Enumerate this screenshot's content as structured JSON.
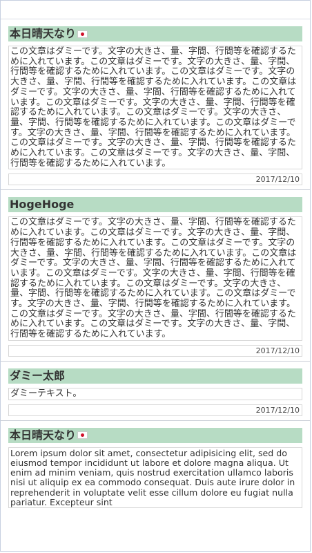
{
  "posts": [
    {
      "title": "本日晴天なり",
      "has_flag": true,
      "body": "この文章はダミーです。文字の大きさ、量、字間、行間等を確認するために入れています。この文章はダミーです。文字の大きさ、量、字間、行間等を確認するために入れています。この文章はダミーです。文字の大きさ、量、字間、行間等を確認するために入れています。この文章はダミーです。文字の大きさ、量、字間、行間等を確認するために入れています。この文章はダミーです。文字の大きさ、量、字間、行間等を確認するために入れています。この文章はダミーです。文字の大きさ、量、字間、行間等を確認するために入れています。この文章はダミーです。文字の大きさ、量、字間、行間等を確認するために入れています。この文章はダミーです。文字の大きさ、量、字間、行間等を確認するために入れています。この文章はダミーです。文字の大きさ、量、字間、行間等を確認するために入れています。",
      "date": "2017/12/10"
    },
    {
      "title": "HogeHoge",
      "has_flag": false,
      "body": "この文章はダミーです。文字の大きさ、量、字間、行間等を確認するために入れています。この文章はダミーです。文字の大きさ、量、字間、行間等を確認するために入れています。この文章はダミーです。文字の大きさ、量、字間、行間等を確認するために入れています。この文章はダミーです。文字の大きさ、量、字間、行間等を確認するために入れています。この文章はダミーです。文字の大きさ、量、字間、行間等を確認するために入れています。この文章はダミーです。文字の大きさ、量、字間、行間等を確認するために入れています。この文章はダミーです。文字の大きさ、量、字間、行間等を確認するために入れています。この文章はダミーです。文字の大きさ、量、字間、行間等を確認するために入れています。この文章はダミーです。文字の大きさ、量、字間、行間等を確認するために入れています。",
      "date": "2017/12/10"
    },
    {
      "title": "ダミー太郎",
      "has_flag": false,
      "body": "ダミーテキスト。",
      "date": "2017/12/10"
    },
    {
      "title": "本日晴天なり",
      "has_flag": true,
      "body": "Lorem ipsum dolor sit amet, consectetur adipisicing elit, sed do eiusmod tempor incididunt ut labore et dolore magna aliqua. Ut enim ad minim veniam, quis nostrud exercitation ullamco laboris nisi ut aliquip ex ea commodo consequat. Duis aute irure dolor in reprehenderit in voluptate velit esse cillum dolore eu fugiat nulla pariatur. Excepteur sint"
    }
  ]
}
